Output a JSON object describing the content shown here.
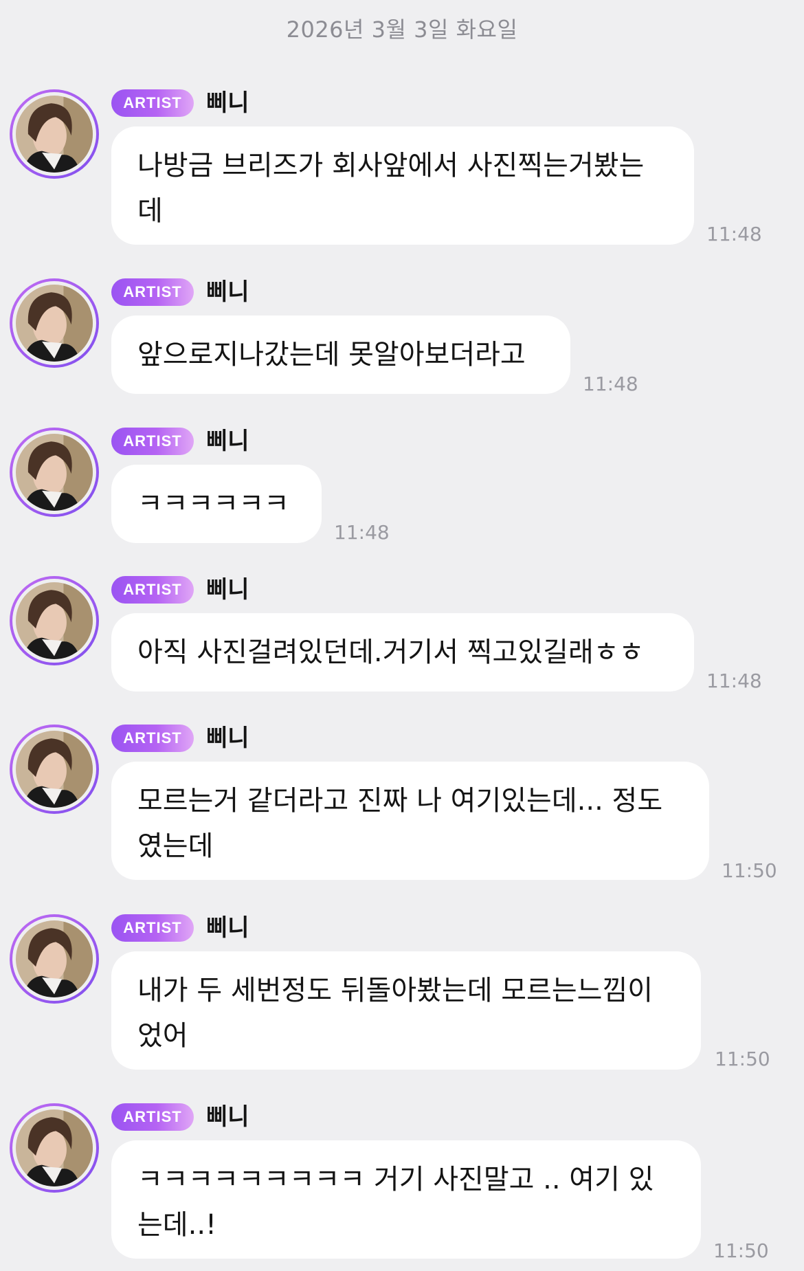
{
  "date_separator": "2026년 3월 3일 화요일",
  "messages": [
    {
      "badge": "ARTIST",
      "sender": "삐니",
      "text": "나방금 브리즈가 회사앞에서 사진찍는거봤는데",
      "time": "11:48"
    },
    {
      "badge": "ARTIST",
      "sender": "삐니",
      "text": "앞으로지나갔는데 못알아보더라고",
      "time": "11:48"
    },
    {
      "badge": "ARTIST",
      "sender": "삐니",
      "text": "ㅋㅋㅋㅋㅋㅋ",
      "time": "11:48"
    },
    {
      "badge": "ARTIST",
      "sender": "삐니",
      "text": "아직 사진걸려있던데.거기서 찍고있길래ㅎㅎ",
      "time": "11:48"
    },
    {
      "badge": "ARTIST",
      "sender": "삐니",
      "text": "모르는거 같더라고 진짜 나 여기있는데... 정도였는데",
      "time": "11:50"
    },
    {
      "badge": "ARTIST",
      "sender": "삐니",
      "text": "내가 두 세번정도 뒤돌아봤는데 모르는느낌이었어",
      "time": "11:50"
    },
    {
      "badge": "ARTIST",
      "sender": "삐니",
      "text": "ㅋㅋㅋㅋㅋㅋㅋㅋㅋ 거기 사진말고 .. 여기 있는데..!",
      "time": "11:50"
    }
  ]
}
